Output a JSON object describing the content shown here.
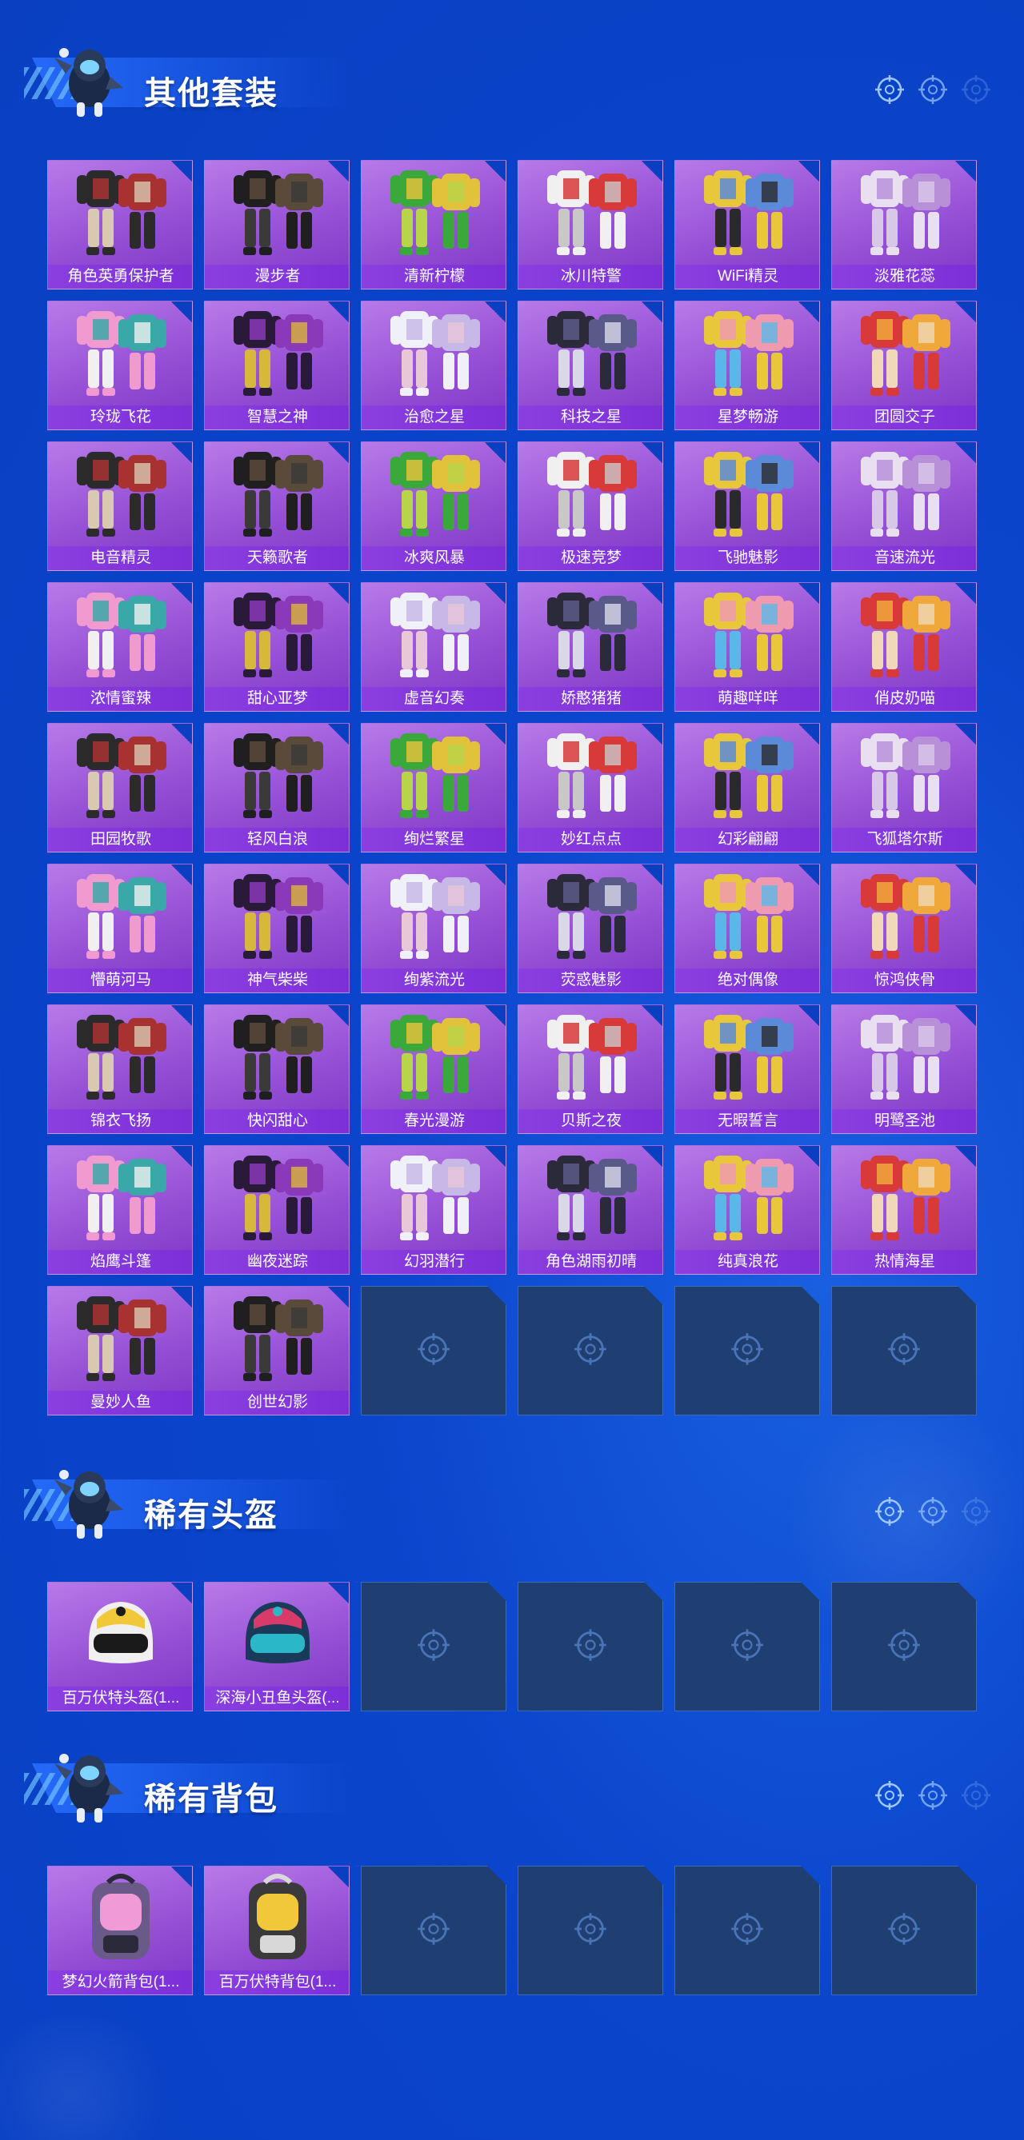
{
  "colors": {
    "background": "#0a3fc2",
    "card_purple": "#9650d6",
    "label_purple": "#8a3fe0",
    "empty_slot": "#1f3f72",
    "empty_border": "#3d6bb3"
  },
  "sections": [
    {
      "title": "其他套装",
      "items": [
        {
          "label": "角色英勇保护者",
          "icon": "mech-suit-icon"
        },
        {
          "label": "漫步者",
          "icon": "pants-icon"
        },
        {
          "label": "清新柠檬",
          "icon": "outfit-icon"
        },
        {
          "label": "冰川特警",
          "icon": "outfit-icon"
        },
        {
          "label": "WiFi精灵",
          "icon": "outfit-icon"
        },
        {
          "label": "淡雅花蕊",
          "icon": "outfit-icon"
        },
        {
          "label": "玲珑飞花",
          "icon": "outfit-icon"
        },
        {
          "label": "智慧之神",
          "icon": "outfit-icon"
        },
        {
          "label": "治愈之星",
          "icon": "outfit-icon"
        },
        {
          "label": "科技之星",
          "icon": "outfit-icon"
        },
        {
          "label": "星梦畅游",
          "icon": "outfit-icon"
        },
        {
          "label": "团圆交子",
          "icon": "outfit-icon"
        },
        {
          "label": "电音精灵",
          "icon": "outfit-icon"
        },
        {
          "label": "天籁歌者",
          "icon": "outfit-icon"
        },
        {
          "label": "冰爽风暴",
          "icon": "outfit-icon"
        },
        {
          "label": "极速竞梦",
          "icon": "outfit-icon"
        },
        {
          "label": "飞驰魅影",
          "icon": "outfit-icon"
        },
        {
          "label": "音速流光",
          "icon": "outfit-icon"
        },
        {
          "label": "浓情蜜辣",
          "icon": "outfit-icon"
        },
        {
          "label": "甜心亚梦",
          "icon": "outfit-icon"
        },
        {
          "label": "虚音幻奏",
          "icon": "outfit-icon"
        },
        {
          "label": "娇憨猪猪",
          "icon": "outfit-icon"
        },
        {
          "label": "萌趣咩咩",
          "icon": "outfit-icon"
        },
        {
          "label": "俏皮奶喵",
          "icon": "outfit-icon"
        },
        {
          "label": "田园牧歌",
          "icon": "outfit-icon"
        },
        {
          "label": "轻风白浪",
          "icon": "outfit-icon"
        },
        {
          "label": "绚烂繁星",
          "icon": "outfit-icon"
        },
        {
          "label": "妙红点点",
          "icon": "outfit-icon"
        },
        {
          "label": "幻彩翩翩",
          "icon": "outfit-icon"
        },
        {
          "label": "飞狐塔尔斯",
          "icon": "outfit-icon"
        },
        {
          "label": "懵萌河马",
          "icon": "outfit-icon"
        },
        {
          "label": "神气柴柴",
          "icon": "outfit-icon"
        },
        {
          "label": "绚紫流光",
          "icon": "outfit-icon"
        },
        {
          "label": "荧惑魅影",
          "icon": "outfit-icon"
        },
        {
          "label": "绝对偶像",
          "icon": "outfit-icon"
        },
        {
          "label": "惊鸿侠骨",
          "icon": "outfit-icon"
        },
        {
          "label": "锦衣飞扬",
          "icon": "outfit-icon"
        },
        {
          "label": "快闪甜心",
          "icon": "outfit-icon"
        },
        {
          "label": "春光漫游",
          "icon": "outfit-icon"
        },
        {
          "label": "贝斯之夜",
          "icon": "outfit-icon"
        },
        {
          "label": "无暇誓言",
          "icon": "outfit-icon"
        },
        {
          "label": "明鹭圣池",
          "icon": "outfit-icon"
        },
        {
          "label": "焰鹰斗篷",
          "icon": "outfit-icon"
        },
        {
          "label": "幽夜迷踪",
          "icon": "outfit-icon"
        },
        {
          "label": "幻羽潜行",
          "icon": "outfit-icon"
        },
        {
          "label": "角色湖雨初晴",
          "icon": "outfit-icon"
        },
        {
          "label": "纯真浪花",
          "icon": "outfit-icon"
        },
        {
          "label": "热情海星",
          "icon": "outfit-icon"
        },
        {
          "label": "曼妙人鱼",
          "icon": "outfit-icon"
        },
        {
          "label": "创世幻影",
          "icon": "outfit-icon"
        }
      ],
      "empty_slots": 4
    },
    {
      "title": "稀有头盔",
      "items": [
        {
          "label": "百万伏特头盔(1...",
          "icon": "helmet-icon"
        },
        {
          "label": "深海小丑鱼头盔(...",
          "icon": "helmet-icon"
        }
      ],
      "empty_slots": 4
    },
    {
      "title": "稀有背包",
      "items": [
        {
          "label": "梦幻火箭背包(1...",
          "icon": "backpack-icon"
        },
        {
          "label": "百万伏特背包(1...",
          "icon": "backpack-icon"
        }
      ],
      "empty_slots": 4
    }
  ]
}
